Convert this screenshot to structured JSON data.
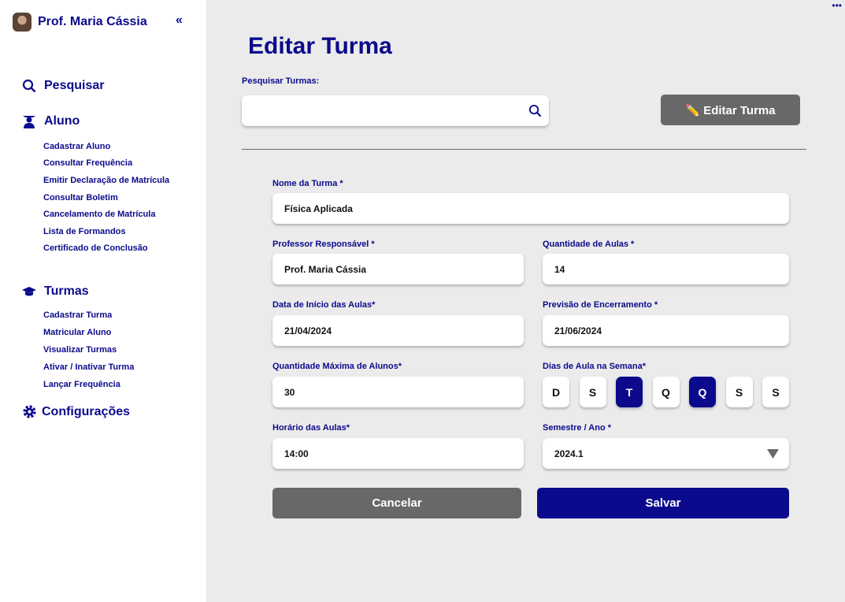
{
  "sidebar": {
    "user": "Prof. Maria Cássia",
    "collapse": "«",
    "search": "Pesquisar",
    "aluno": "Aluno",
    "aluno_items": [
      "Cadastrar Aluno",
      "Consultar Frequência",
      "Emitir Declaração de Matrícula",
      "Consultar Boletim",
      "Cancelamento de Matrícula",
      "Lista de Formandos",
      "Certificado de Conclusão"
    ],
    "turmas": "Turmas",
    "turmas_items": [
      "Cadastrar Turma",
      "Matricular Aluno",
      "Visualizar Turmas",
      "Ativar / Inativar Turma",
      "Lançar Frequência"
    ],
    "config": "Configurações"
  },
  "menu": "•••",
  "title": "Editar Turma",
  "search": {
    "label": "Pesquisar Turmas:",
    "value": ""
  },
  "edit_button": "✏️ Editar Turma",
  "form": {
    "nome_label": "Nome da Turma *",
    "nome": "Física Aplicada",
    "prof_label": "Professor Responsável *",
    "prof": "Prof. Maria Cássia",
    "qtd_label": "Quantidade de Aulas *",
    "qtd": "14",
    "inicio_label": "Data de Início das Aulas*",
    "inicio": "21/04/2024",
    "fim_label": "Previsão de Encerramento *",
    "fim": "21/06/2024",
    "max_label": "Quantidade Máxima de Alunos*",
    "max": "30",
    "dias_label": "Dias de Aula na Semana*",
    "dias": [
      {
        "l": "D",
        "on": false
      },
      {
        "l": "S",
        "on": false
      },
      {
        "l": "T",
        "on": true
      },
      {
        "l": "Q",
        "on": false
      },
      {
        "l": "Q",
        "on": true
      },
      {
        "l": "S",
        "on": false
      },
      {
        "l": "S",
        "on": false
      }
    ],
    "hora_label": "Horário das Aulas*",
    "hora": "14:00",
    "sem_label": "Semestre / Ano *",
    "sem": "2024.1"
  },
  "cancel": "Cancelar",
  "save": "Salvar",
  "colors": {
    "primary": "#0c0a8c",
    "gray": "#686868"
  }
}
